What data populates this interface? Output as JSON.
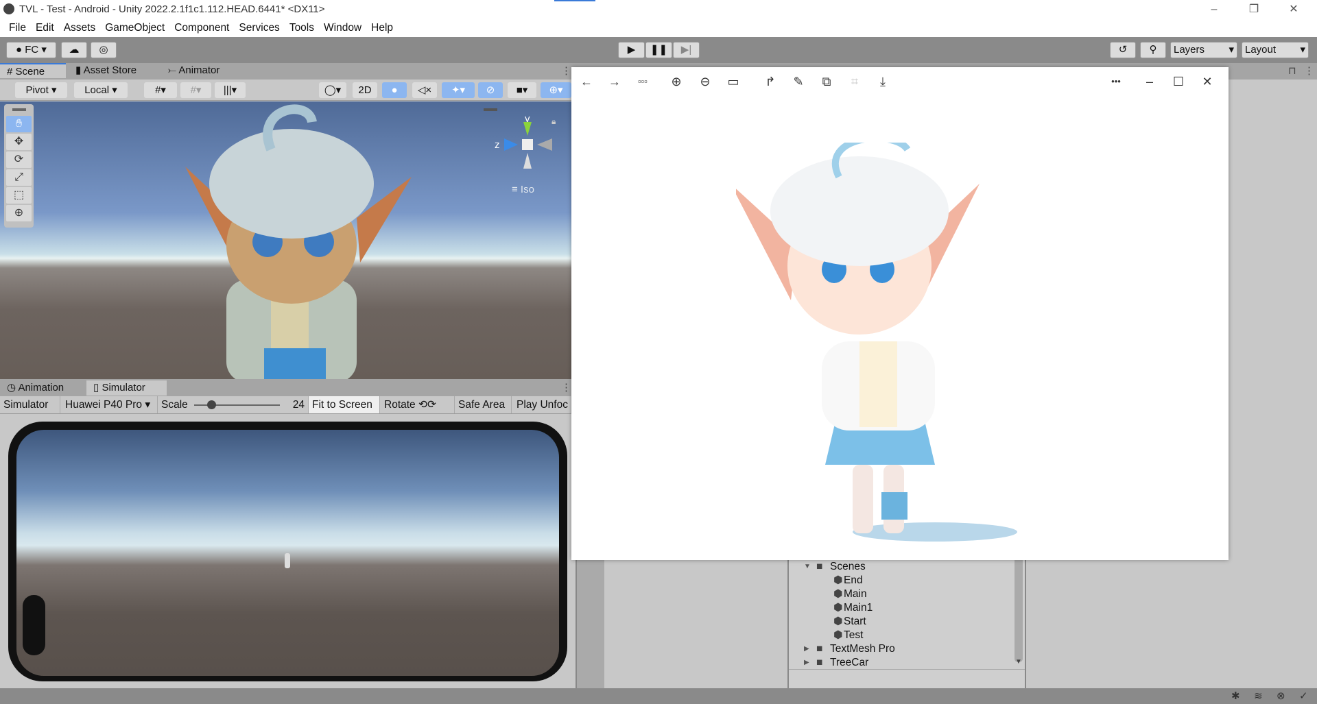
{
  "title": "TVL - Test - Android - Unity 2022.2.1f1c1.112.HEAD.6441* <DX11>",
  "window_controls": {
    "minimize": "–",
    "restore": "❐",
    "close": "✕"
  },
  "menu": [
    "File",
    "Edit",
    "Assets",
    "GameObject",
    "Component",
    "Services",
    "Tools",
    "Window",
    "Help"
  ],
  "toolbar": {
    "account": "FC",
    "layers": "Layers",
    "layout": "Layout"
  },
  "top_tabs": [
    "Scene",
    "Asset Store",
    "Animator"
  ],
  "scene_toolbar": {
    "pivot": "Pivot",
    "local": "Local",
    "mode2d": "2D"
  },
  "gizmo": {
    "y": "y",
    "z": "z",
    "projection": "Iso"
  },
  "bottom_tabs": [
    "Animation",
    "Simulator"
  ],
  "simulator": {
    "view": "Simulator",
    "device": "Huawei P40 Pro",
    "scale_label": "Scale",
    "scale_value": "24",
    "scale_fraction": 0.2,
    "fit": "Fit to Screen",
    "rotate": "Rotate",
    "safe_area": "Safe Area",
    "play_unfocused": "Play Unfoc"
  },
  "project": {
    "items": [
      {
        "label": "Scenes",
        "type": "folder-open",
        "expanded": true
      },
      {
        "label": "End",
        "type": "scene"
      },
      {
        "label": "Main",
        "type": "scene"
      },
      {
        "label": "Main1",
        "type": "scene"
      },
      {
        "label": "Start",
        "type": "scene"
      },
      {
        "label": "Test",
        "type": "scene"
      },
      {
        "label": "TextMesh Pro",
        "type": "folder"
      },
      {
        "label": "TreeCar",
        "type": "folder"
      }
    ]
  },
  "viewer": {
    "more": "•••",
    "min": "–",
    "max": "☐",
    "close": "✕"
  },
  "colors": {
    "accent": "#3a7ad8",
    "toolbar": "#8a8a8a",
    "panel": "#c8c8c8",
    "active_tool": "#8cb6f0"
  }
}
